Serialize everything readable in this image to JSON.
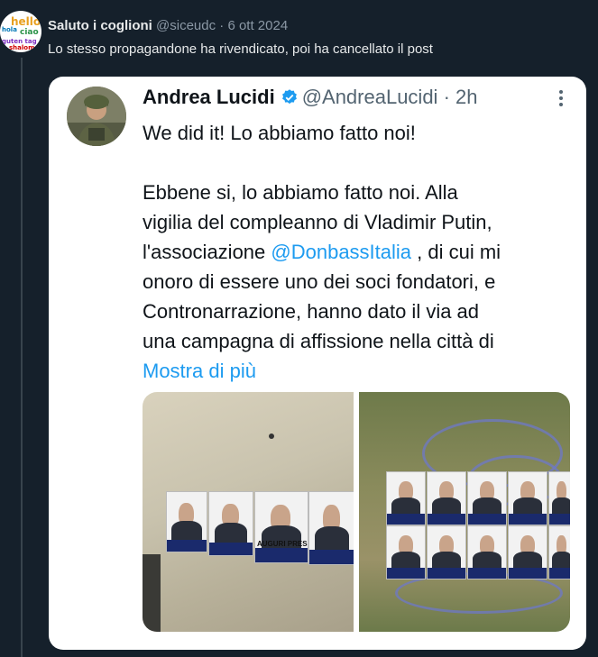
{
  "outer": {
    "name": "Saluto i coglioni",
    "handle": "@siceudc",
    "separator": "·",
    "date": "6 ott 2024",
    "text": "Lo stesso propagandone ha rivendicato, poi ha cancellato il post",
    "avatar_words": [
      "hello",
      "ciao",
      "guten tag",
      "shalom",
      "hola"
    ]
  },
  "quoted": {
    "name": "Andrea Lucidi",
    "handle": "@AndreaLucidi",
    "separator": "·",
    "time": "2h",
    "line1": "We did it! Lo abbiamo fatto noi!",
    "body_lines": [
      "Ebbene si, lo abbiamo fatto noi. Alla",
      "vigilia del compleanno di Vladimir Putin,"
    ],
    "line_assoc_pre": "l'associazione ",
    "mention": "@DonbassItalia",
    "line_assoc_post": " , di cui mi",
    "body_lines2": [
      "onoro di essere uno dei soci fondatori, e",
      "Contronarrazione, hanno dato il via ad",
      "una campagna di affissione nella città di"
    ],
    "show_more": "Mostra di più",
    "poster_caption": "AUGURI PRESIDENTE!"
  },
  "colors": {
    "background": "#15202b",
    "card": "#ffffff",
    "link": "#1d9bf0",
    "verified": "#1d9bf0"
  }
}
